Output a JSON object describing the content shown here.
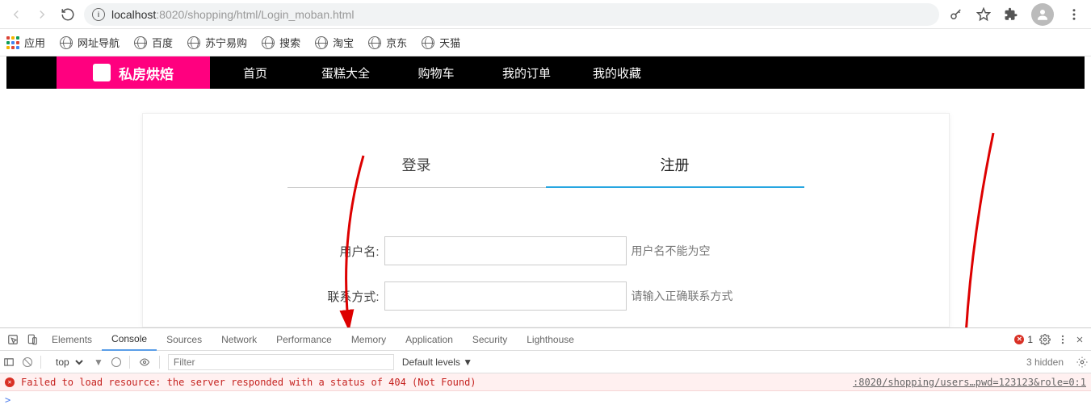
{
  "browser": {
    "url_host": "localhost",
    "url_port": ":8020",
    "url_path": "/shopping/html/Login_moban.html"
  },
  "bookmarks": {
    "apps_label": "应用",
    "items": [
      "网址导航",
      "百度",
      "苏宁易购",
      "搜索",
      "淘宝",
      "京东",
      "天猫"
    ]
  },
  "site_nav": {
    "brand": "私房烘焙",
    "items": [
      "首页",
      "蛋糕大全",
      "购物车",
      "我的订单",
      "我的收藏"
    ]
  },
  "form": {
    "tabs": {
      "login": "登录",
      "register": "注册"
    },
    "rows": [
      {
        "label": "用户名:",
        "hint": "用户名不能为空"
      },
      {
        "label": "联系方式:",
        "hint": "请输入正确联系方式"
      }
    ]
  },
  "devtools": {
    "tabs": [
      "Elements",
      "Console",
      "Sources",
      "Network",
      "Performance",
      "Memory",
      "Application",
      "Security",
      "Lighthouse"
    ],
    "active_tab": "Console",
    "error_count": "1",
    "context": "top",
    "filter_placeholder": "Filter",
    "levels": "Default levels ▼",
    "hidden": "3 hidden",
    "error_msg": "Failed to load resource: the server responded with a status of 404 (Not Found)",
    "error_src": ":8020/shopping/users…pwd=123123&role=0:1",
    "prompt": ">"
  }
}
